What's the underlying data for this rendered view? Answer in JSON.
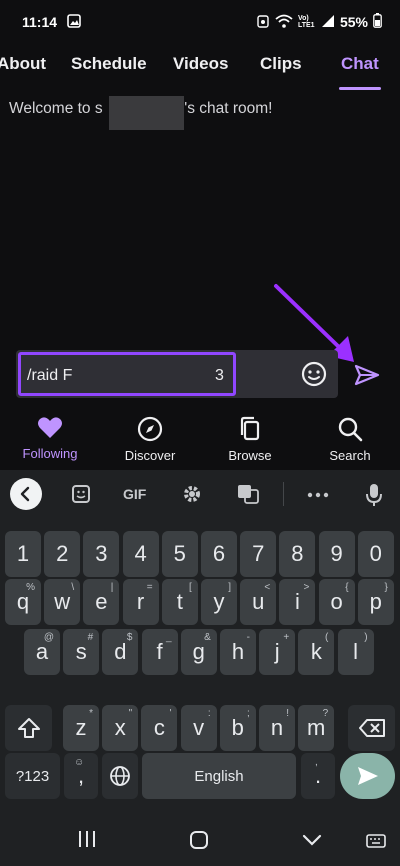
{
  "status": {
    "time": "11:14",
    "battery": "55%",
    "network": "Vo) LTE1"
  },
  "tabs": [
    {
      "label": "About"
    },
    {
      "label": "Schedule"
    },
    {
      "label": "Videos"
    },
    {
      "label": "Clips"
    },
    {
      "label": "Chat",
      "active": true
    }
  ],
  "chat": {
    "welcome_prefix": "Welcome to s",
    "welcome_suffix": "1's chat room!",
    "input_value": "/raid F",
    "input_count": "3"
  },
  "bottom_nav": [
    {
      "label": "Following",
      "icon": "heart-icon",
      "active": true
    },
    {
      "label": "Discover",
      "icon": "compass-icon"
    },
    {
      "label": "Browse",
      "icon": "browse-icon"
    },
    {
      "label": "Search",
      "icon": "search-icon"
    }
  ],
  "keyboard": {
    "toolbar": {
      "gif": "GIF"
    },
    "row_numbers": [
      "1",
      "2",
      "3",
      "4",
      "5",
      "6",
      "7",
      "8",
      "9",
      "0"
    ],
    "row1": [
      {
        "k": "q",
        "s": "%"
      },
      {
        "k": "w",
        "s": "\\"
      },
      {
        "k": "e",
        "s": "|"
      },
      {
        "k": "r",
        "s": "="
      },
      {
        "k": "t",
        "s": "["
      },
      {
        "k": "y",
        "s": "]"
      },
      {
        "k": "u",
        "s": "<"
      },
      {
        "k": "i",
        "s": ">"
      },
      {
        "k": "o",
        "s": "{"
      },
      {
        "k": "p",
        "s": "}"
      }
    ],
    "row2": [
      {
        "k": "a",
        "s": "@"
      },
      {
        "k": "s",
        "s": "#"
      },
      {
        "k": "d",
        "s": "$"
      },
      {
        "k": "f",
        "s": "_"
      },
      {
        "k": "g",
        "s": "&"
      },
      {
        "k": "h",
        "s": "-"
      },
      {
        "k": "j",
        "s": "+"
      },
      {
        "k": "k",
        "s": "("
      },
      {
        "k": "l",
        "s": ")"
      }
    ],
    "row3": [
      {
        "k": "z",
        "s": "*"
      },
      {
        "k": "x",
        "s": "\""
      },
      {
        "k": "c",
        "s": "'"
      },
      {
        "k": "v",
        "s": ":"
      },
      {
        "k": "b",
        "s": ";"
      },
      {
        "k": "n",
        "s": "!"
      },
      {
        "k": "m",
        "s": "?"
      }
    ],
    "symbols_key": "?123",
    "comma_key": ",",
    "comma_sup": "☺",
    "space_label": "English",
    "period_key": ".",
    "period_sup": ","
  },
  "colors": {
    "accent": "#9147ff",
    "accent_light": "#bf94ff",
    "background": "#0e0e10"
  }
}
